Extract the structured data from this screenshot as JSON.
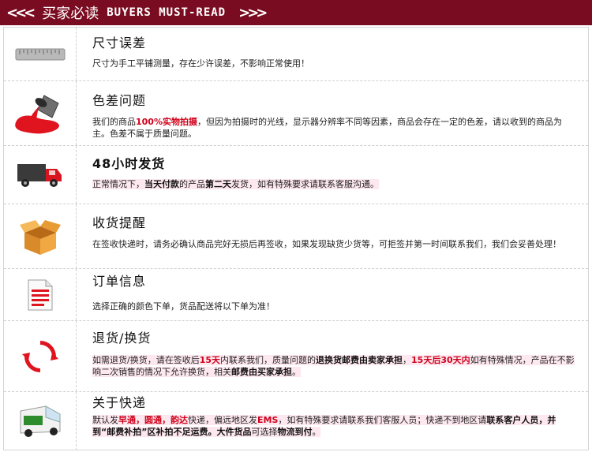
{
  "header": {
    "left_arrows": "<<<",
    "title_cn": "买家必读",
    "title_en": "BUYERS MUST-READ",
    "right_arrows": ">>>"
  },
  "sections": [
    {
      "icon": "ruler-icon",
      "title": "尺寸误差",
      "text": "尺寸为手工平铺测量，存在少许误差，不影响正常使用！"
    },
    {
      "icon": "paint-can-icon",
      "title": "色差问题",
      "text_a": "我们的商品",
      "text_b": "100%实物拍摄",
      "text_c": "，但因为拍摄时的光线，显示器分辨率不同等因素，商品会存在一定的色差，请以收到的商品为主。色差不属于质量问题。"
    },
    {
      "icon": "delivery-truck-icon",
      "title": "48小时发货",
      "text_a": "正常情况下，",
      "text_b": "当天付款",
      "text_c": "的产品",
      "text_d": "第二天",
      "text_e": "发货，如有特殊要求请联系客服沟通。"
    },
    {
      "icon": "open-box-icon",
      "title": "收货提醒",
      "text": "在签收快递时，请务必确认商品完好无损后再签收，如果发现缺货少货等，可拒签并第一时间联系我们，我们会妥善处理！"
    },
    {
      "icon": "order-document-icon",
      "title": "订单信息",
      "text": "选择正确的颜色下单，货品配送将以下单为准！"
    },
    {
      "icon": "exchange-arrows-icon",
      "title": "退货/换货",
      "text_a": "如需退货/换货，请在签收后",
      "text_b": "15天",
      "text_c": "内联系我们，质量问题的",
      "text_d": "退换货邮费由卖家承担",
      "text_e": "，",
      "text_f": "15天后30天内",
      "text_g": "如有特殊情况，产品在不影响二次销售的情况下允许换货，相关",
      "text_h": "邮费由买家承担",
      "text_i": "。"
    },
    {
      "icon": "courier-van-icon",
      "title": "关于快递",
      "text_a": "默认发",
      "text_b": "早通，圆通，韵达",
      "text_c": "快递，偏远地区发",
      "text_d": "EMS",
      "text_e": "，如有特殊要求请联系我们客服人员；快递不到地区请",
      "text_f": "联系客户人员，并到“邮费补拍”区补拍不足运费。大件货品",
      "text_g": "可选择",
      "text_h": "物流到付",
      "text_i": "。"
    }
  ],
  "colors": {
    "banner": "#7a0c21",
    "accent_red": "#d0021b",
    "highlight": "#fde8f0"
  }
}
